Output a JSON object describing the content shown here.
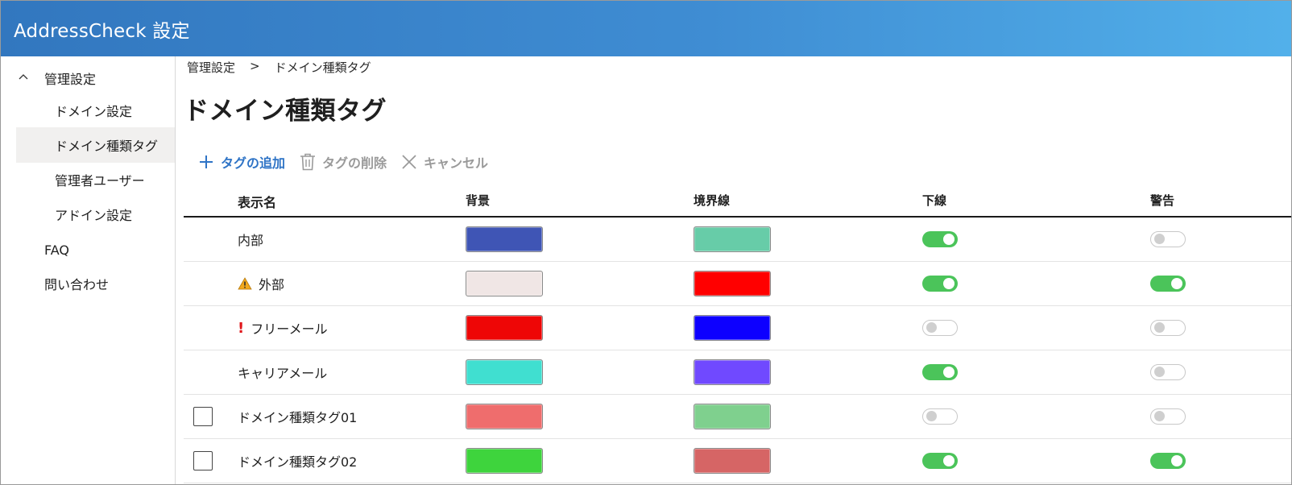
{
  "app": {
    "title": "AddressCheck 設定"
  },
  "sidebar": {
    "group_label": "管理設定",
    "items": [
      {
        "label": "ドメイン設定"
      },
      {
        "label": "ドメイン種類タグ"
      },
      {
        "label": "管理者ユーザー"
      },
      {
        "label": "アドイン設定"
      },
      {
        "label": "FAQ"
      },
      {
        "label": "問い合わせ"
      }
    ]
  },
  "breadcrumb": {
    "parent": "管理設定",
    "separator": ">",
    "current": "ドメイン種類タグ"
  },
  "page": {
    "title": "ドメイン種類タグ"
  },
  "toolbar": {
    "add_label": "タグの追加",
    "delete_label": "タグの削除",
    "cancel_label": "キャンセル"
  },
  "table": {
    "columns": {
      "name": "表示名",
      "background": "背景",
      "border": "境界線",
      "underline": "下線",
      "warning": "警告"
    },
    "rows": [
      {
        "name": "内部",
        "icon": "",
        "checkbox": false,
        "bg": "#3f55b5",
        "border": "#67cca8",
        "underline": true,
        "warning": false
      },
      {
        "name": "外部",
        "icon": "warning-icon",
        "checkbox": false,
        "bg": "#f0e6e5",
        "border": "#ff0000",
        "underline": true,
        "warning": true
      },
      {
        "name": "フリーメール",
        "icon": "exclamation-icon",
        "checkbox": false,
        "bg": "#ee0606",
        "border": "#0d00ff",
        "underline": false,
        "warning": false
      },
      {
        "name": "キャリアメール",
        "icon": "",
        "checkbox": false,
        "bg": "#40dfd0",
        "border": "#7049ff",
        "underline": true,
        "warning": false
      },
      {
        "name": "ドメイン種類タグ01",
        "icon": "",
        "checkbox": true,
        "bg": "#ef6d6d",
        "border": "#7fd08e",
        "underline": false,
        "warning": false
      },
      {
        "name": "ドメイン種類タグ02",
        "icon": "",
        "checkbox": true,
        "bg": "#3ed43d",
        "border": "#d66565",
        "underline": true,
        "warning": true
      }
    ]
  }
}
